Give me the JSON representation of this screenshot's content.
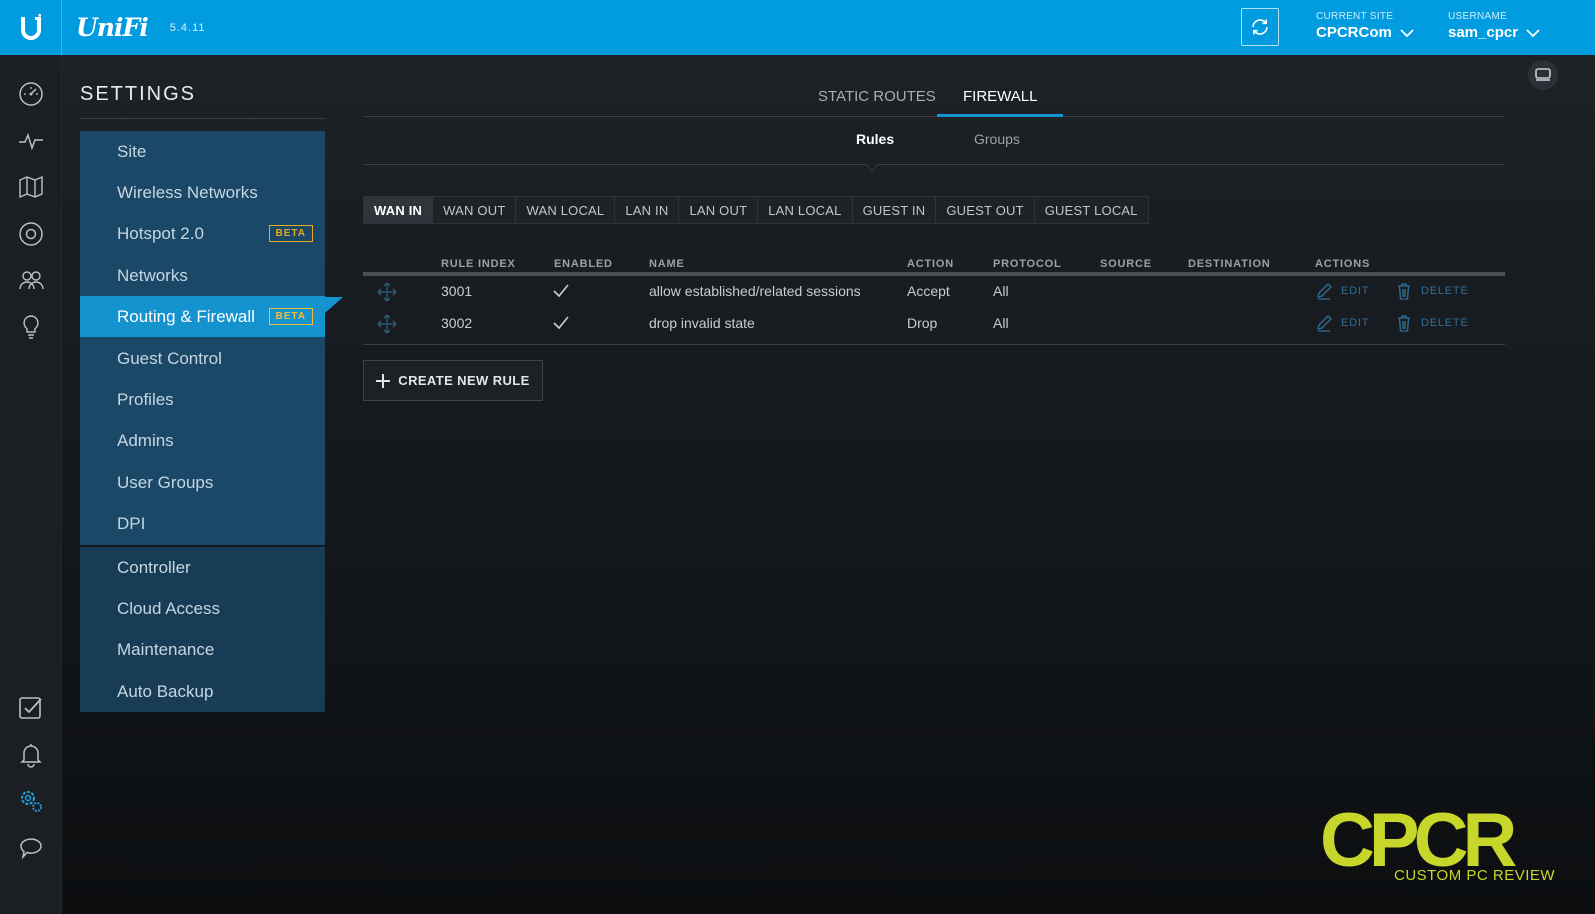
{
  "header": {
    "brand": "UniFi",
    "version": "5.4.11",
    "current_site_label": "CURRENT SITE",
    "current_site": "CPCRCom",
    "username_label": "USERNAME",
    "username": "sam_cpcr",
    "accent_color": "#019be0"
  },
  "rail": {
    "icons": [
      "dashboard-icon",
      "statistics-icon",
      "map-icon",
      "devices-icon",
      "clients-icon",
      "insights-icon",
      "events-icon",
      "alerts-icon",
      "settings-icon",
      "chat-icon"
    ]
  },
  "settings": {
    "title": "SETTINGS",
    "items": [
      {
        "label": "Site"
      },
      {
        "label": "Wireless Networks"
      },
      {
        "label": "Hotspot 2.0",
        "badge": "BETA"
      },
      {
        "label": "Networks"
      },
      {
        "label": "Routing & Firewall",
        "badge": "BETA",
        "active": true
      },
      {
        "label": "Guest Control"
      },
      {
        "label": "Profiles"
      },
      {
        "label": "Admins"
      },
      {
        "label": "User Groups"
      },
      {
        "label": "DPI"
      }
    ],
    "items2": [
      {
        "label": "Controller"
      },
      {
        "label": "Cloud Access"
      },
      {
        "label": "Maintenance"
      },
      {
        "label": "Auto Backup"
      }
    ]
  },
  "tabs": [
    {
      "label": "STATIC ROUTES"
    },
    {
      "label": "FIREWALL",
      "active": true
    }
  ],
  "subtabs": [
    {
      "label": "Rules",
      "active": true
    },
    {
      "label": "Groups"
    }
  ],
  "segments": [
    "WAN IN",
    "WAN OUT",
    "WAN LOCAL",
    "LAN IN",
    "LAN OUT",
    "LAN LOCAL",
    "GUEST IN",
    "GUEST OUT",
    "GUEST LOCAL"
  ],
  "table": {
    "columns": [
      "RULE INDEX",
      "ENABLED",
      "NAME",
      "ACTION",
      "PROTOCOL",
      "SOURCE",
      "DESTINATION",
      "ACTIONS"
    ],
    "rows": [
      {
        "index": "3001",
        "enabled": true,
        "name": "allow established/related sessions",
        "action": "Accept",
        "protocol": "All",
        "source": "",
        "destination": ""
      },
      {
        "index": "3002",
        "enabled": true,
        "name": "drop invalid state",
        "action": "Drop",
        "protocol": "All",
        "source": "",
        "destination": ""
      }
    ],
    "edit_label": "EDIT",
    "delete_label": "DELETE"
  },
  "create_button": "CREATE NEW RULE",
  "watermark": {
    "logo": "CPCR",
    "subtitle": "CUSTOM PC REVIEW",
    "color": "#c8d62b"
  }
}
